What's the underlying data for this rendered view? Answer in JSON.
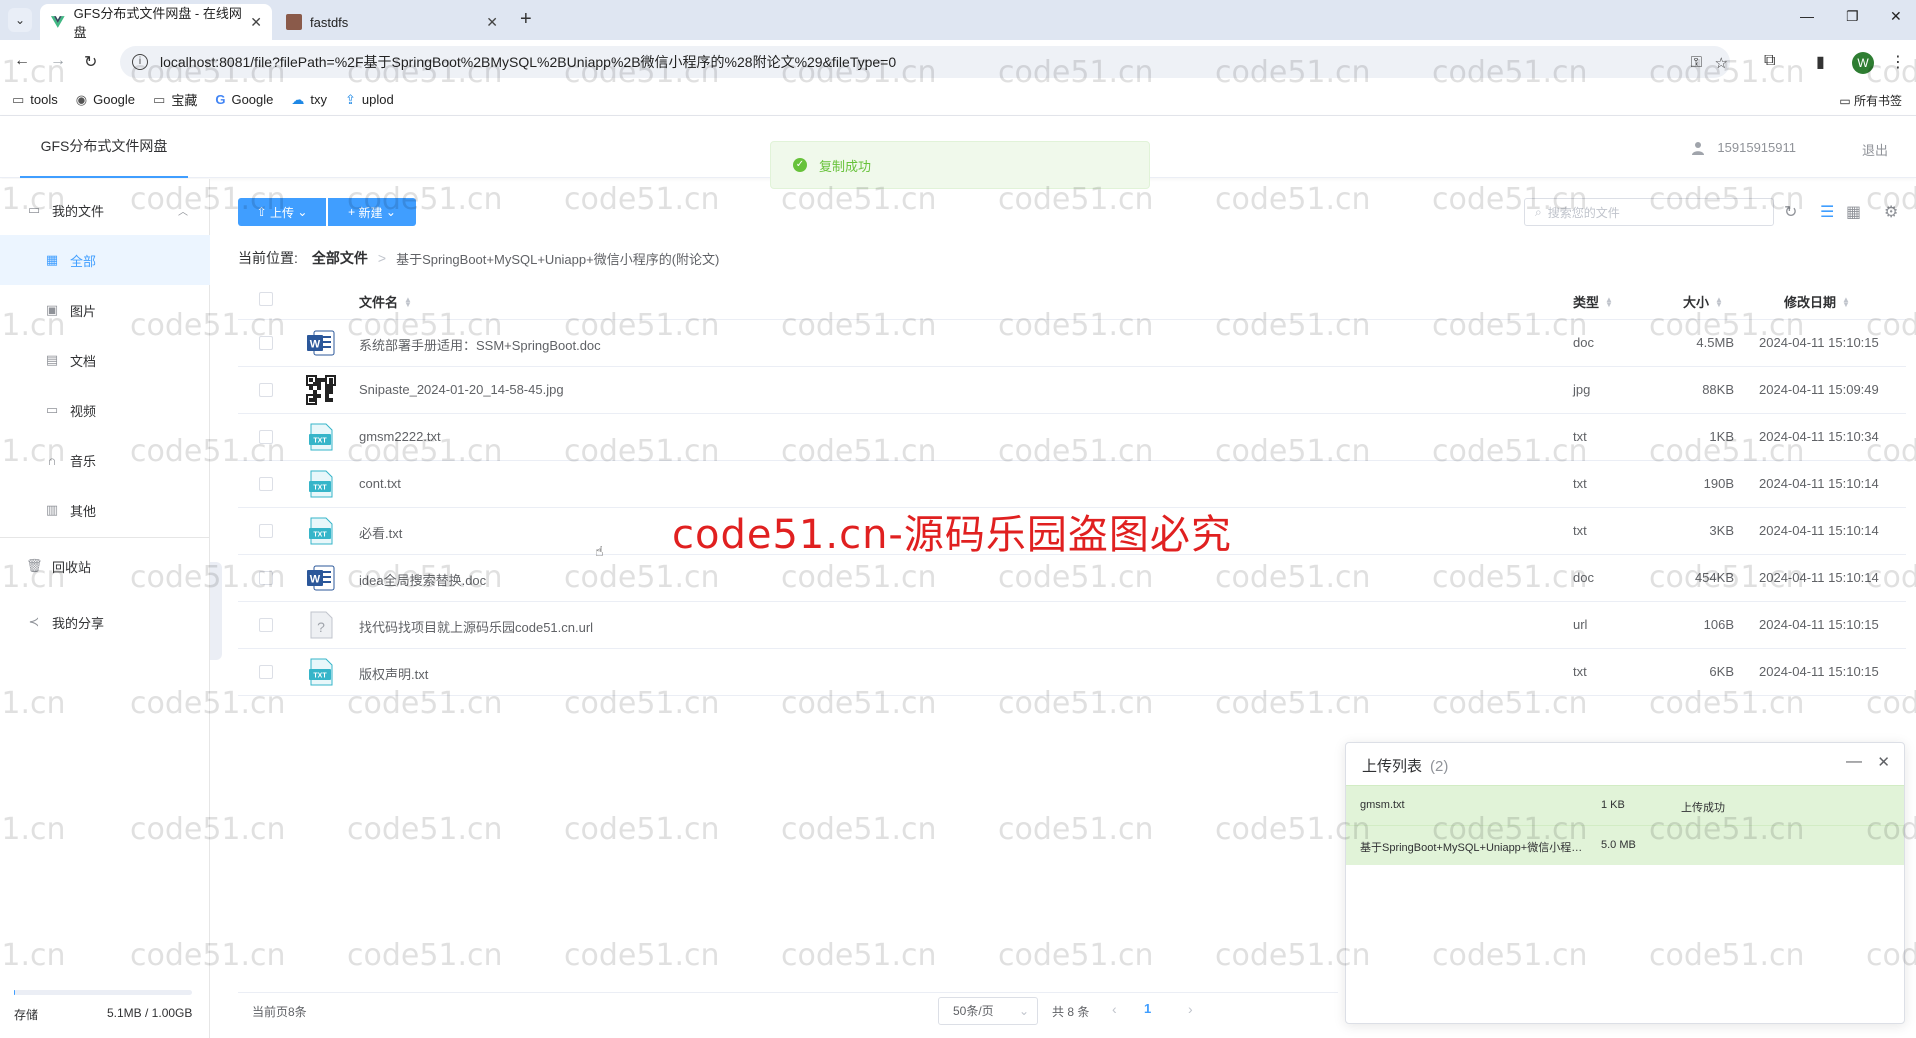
{
  "browser": {
    "tabs": [
      {
        "title": "GFS分布式文件网盘 - 在线网盘",
        "active": true
      },
      {
        "title": "fastdfs",
        "active": false
      }
    ],
    "url": "localhost:8081/file?filePath=%2F基于SpringBoot%2BMySQL%2BUniapp%2B微信小程序的%28附论文%29&fileType=0",
    "profile_initial": "W",
    "bookmarks": [
      {
        "label": "tools",
        "icon": "folder-icon"
      },
      {
        "label": "Google",
        "icon": "globe-icon"
      },
      {
        "label": "宝藏",
        "icon": "folder-icon"
      },
      {
        "label": "Google",
        "icon": "google-icon"
      },
      {
        "label": "txy",
        "icon": "cloud-icon"
      },
      {
        "label": "uplod",
        "icon": "upload-icon"
      }
    ],
    "all_bookmarks": "所有书签"
  },
  "header": {
    "app_title": "GFS分布式文件网盘",
    "phone": "15915915911",
    "logout": "退出",
    "toast": "复制成功"
  },
  "sidebar": {
    "my_files": "我的文件",
    "items": [
      {
        "label": "全部",
        "icon": "grid-icon",
        "active": true
      },
      {
        "label": "图片",
        "icon": "image-icon"
      },
      {
        "label": "文档",
        "icon": "document-icon"
      },
      {
        "label": "视频",
        "icon": "video-icon"
      },
      {
        "label": "音乐",
        "icon": "headphones-icon"
      },
      {
        "label": "其他",
        "icon": "box-icon"
      }
    ],
    "recycle": "回收站",
    "share": "我的分享",
    "storage_label": "存储",
    "storage_value": "5.1MB / 1.00GB",
    "storage_fraction": 0.005
  },
  "toolbar": {
    "upload": "上传",
    "new": "新建",
    "search_placeholder": "搜索您的文件"
  },
  "breadcrumb": {
    "label": "当前位置:",
    "root": "全部文件",
    "current": "基于SpringBoot+MySQL+Uniapp+微信小程序的(附论文)"
  },
  "table": {
    "headers": {
      "name": "文件名",
      "type": "类型",
      "size": "大小",
      "date": "修改日期"
    },
    "rows": [
      {
        "name": "系统部署手册适用：SSM+SpringBoot.doc",
        "type": "doc",
        "size": "4.5MB",
        "date": "2024-04-11 15:10:15",
        "icon": "word"
      },
      {
        "name": "Snipaste_2024-01-20_14-58-45.jpg",
        "type": "jpg",
        "size": "88KB",
        "date": "2024-04-11 15:09:49",
        "icon": "qr"
      },
      {
        "name": "gmsm2222.txt",
        "type": "txt",
        "size": "1KB",
        "date": "2024-04-11 15:10:34",
        "icon": "txt"
      },
      {
        "name": "cont.txt",
        "type": "txt",
        "size": "190B",
        "date": "2024-04-11 15:10:14",
        "icon": "txt"
      },
      {
        "name": "必看.txt",
        "type": "txt",
        "size": "3KB",
        "date": "2024-04-11 15:10:14",
        "icon": "txt"
      },
      {
        "name": "idea全局搜索替换.doc",
        "type": "doc",
        "size": "454KB",
        "date": "2024-04-11 15:10:14",
        "icon": "word"
      },
      {
        "name": "找代码找项目就上源码乐园code51.cn.url",
        "type": "url",
        "size": "106B",
        "date": "2024-04-11 15:10:15",
        "icon": "unknown"
      },
      {
        "name": "版权声明.txt",
        "type": "txt",
        "size": "6KB",
        "date": "2024-04-11 15:10:15",
        "icon": "txt"
      }
    ]
  },
  "pager": {
    "info": "当前页8条",
    "page_size": "50条/页",
    "total": "共 8 条",
    "current": "1"
  },
  "upload_panel": {
    "title": "上传列表",
    "count": "(2)",
    "items": [
      {
        "name": "gmsm.txt",
        "size": "1 KB",
        "status": "上传成功"
      },
      {
        "name": "基于SpringBoot+MySQL+Uniapp+微信小程序的(附论文).zip",
        "size": "5.0 MB",
        "status": ""
      }
    ]
  },
  "watermark": {
    "text": "code51.cn",
    "banner": "code51.cn-源码乐园盗图必究"
  },
  "colors": {
    "primary": "#409eff",
    "success": "#67c23a",
    "success_bg": "#e1f3d8",
    "watermark_red": "#e02020",
    "word_blue": "#2b579a",
    "txt_teal": "#36b5c9"
  }
}
